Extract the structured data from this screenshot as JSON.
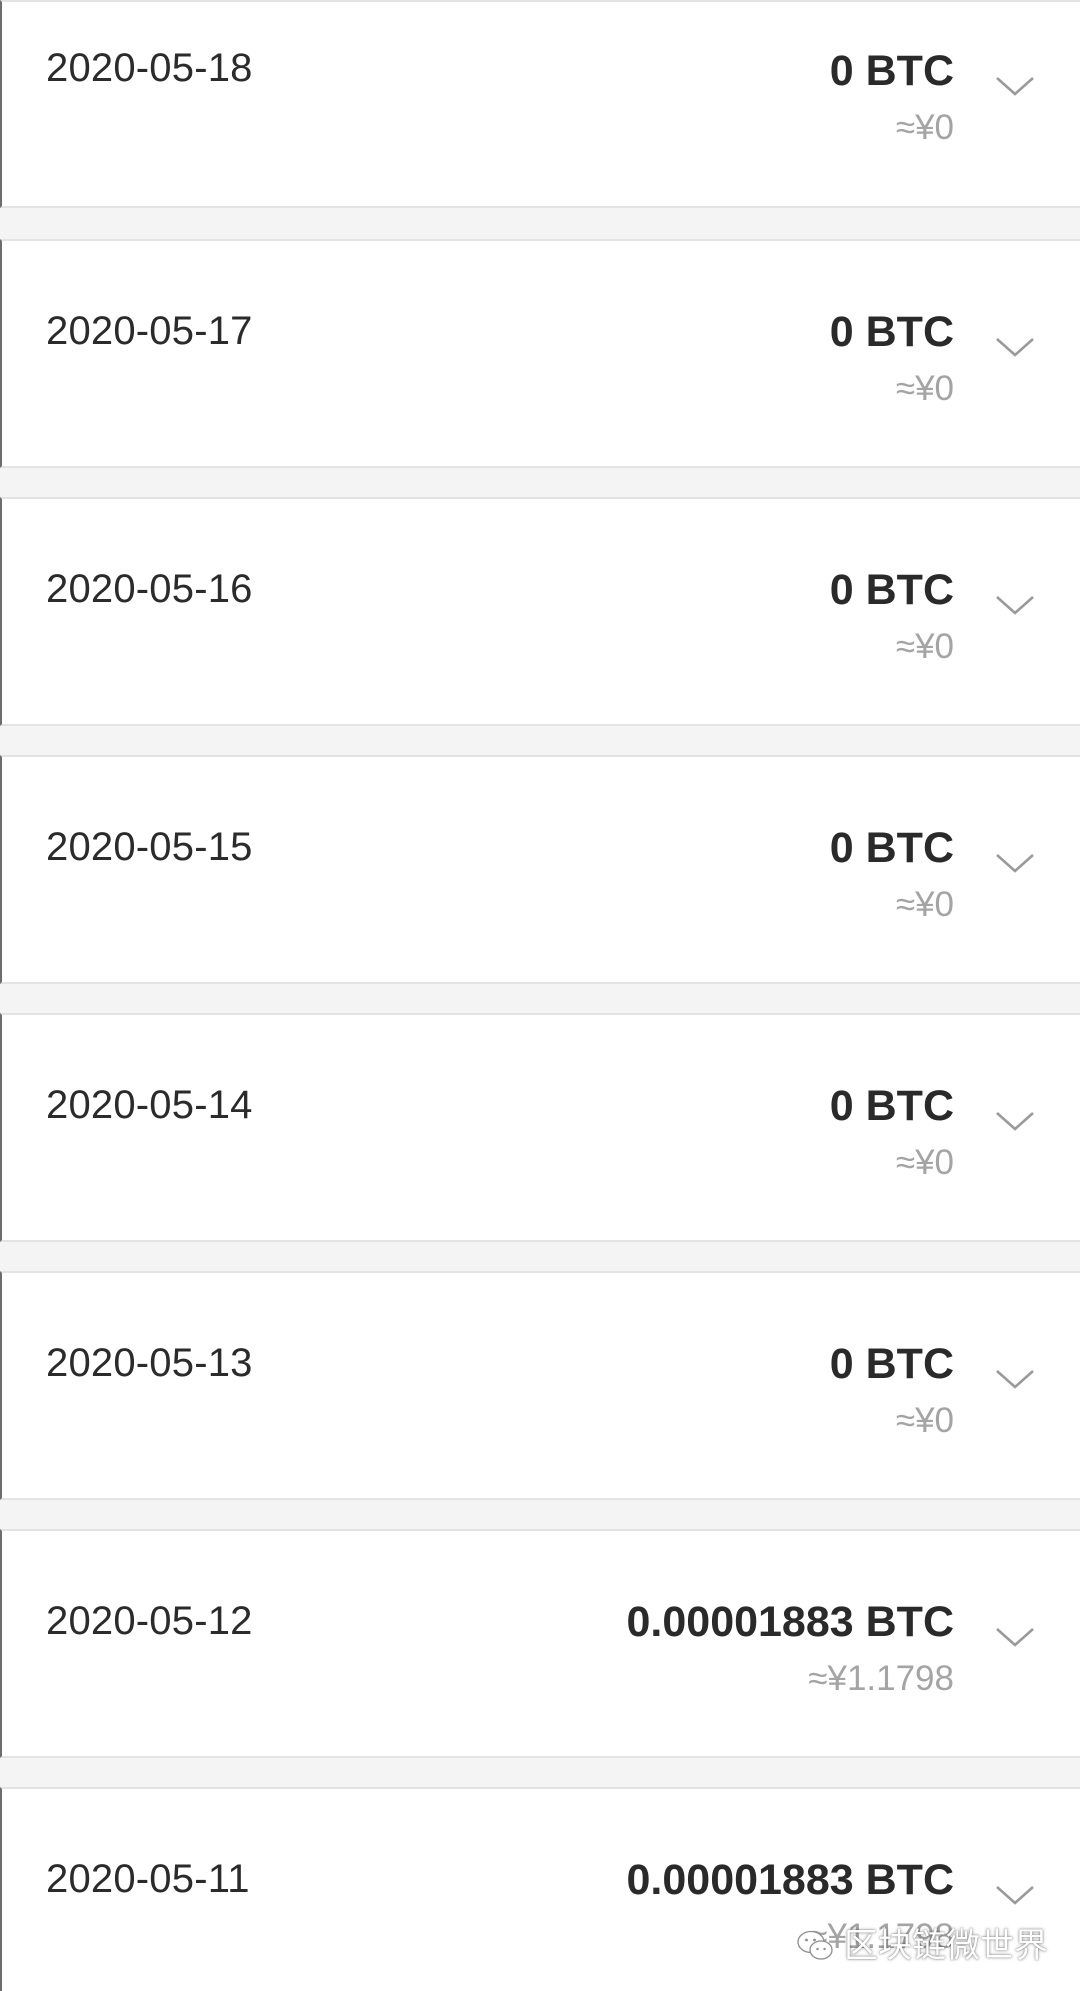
{
  "records": [
    {
      "date": "2020-05-18",
      "amount": "0 BTC",
      "fiat": "≈¥0",
      "expand_icon": "chevron-down-icon"
    },
    {
      "date": "2020-05-17",
      "amount": "0 BTC",
      "fiat": "≈¥0",
      "expand_icon": "chevron-down-icon"
    },
    {
      "date": "2020-05-16",
      "amount": "0 BTC",
      "fiat": "≈¥0",
      "expand_icon": "chevron-down-icon"
    },
    {
      "date": "2020-05-15",
      "amount": "0 BTC",
      "fiat": "≈¥0",
      "expand_icon": "chevron-down-icon"
    },
    {
      "date": "2020-05-14",
      "amount": "0 BTC",
      "fiat": "≈¥0",
      "expand_icon": "chevron-down-icon"
    },
    {
      "date": "2020-05-13",
      "amount": "0 BTC",
      "fiat": "≈¥0",
      "expand_icon": "chevron-down-icon"
    },
    {
      "date": "2020-05-12",
      "amount": "0.00001883 BTC",
      "fiat": "≈¥1.1798",
      "expand_icon": "chevron-down-icon"
    },
    {
      "date": "2020-05-11",
      "amount": "0.00001883 BTC",
      "fiat": "≈¥1.1798",
      "expand_icon": "chevron-down-icon"
    }
  ],
  "watermark": {
    "text": "区块链微世界",
    "icon": "wechat-icon"
  },
  "colors": {
    "amount": "#2a2a2a",
    "fiat": "#a4a4a4",
    "separator": "#f4f4f4",
    "row": "#ffffff",
    "chevron": "#9a9a9a"
  }
}
